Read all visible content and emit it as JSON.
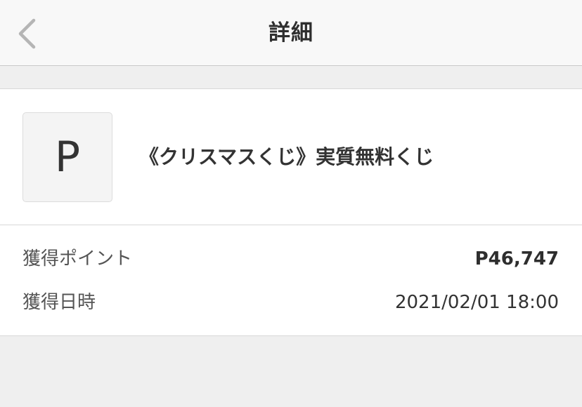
{
  "nav": {
    "title": "詳細",
    "back_icon": "chevron-left-icon",
    "accent_color": "#b5b5b5"
  },
  "item": {
    "icon_letter": "P",
    "title": "《クリスマスくじ》実質無料くじ"
  },
  "details": [
    {
      "label": "獲得ポイント",
      "value": "P46,747"
    },
    {
      "label": "獲得日時",
      "value": "2021/02/01 18:00"
    }
  ]
}
